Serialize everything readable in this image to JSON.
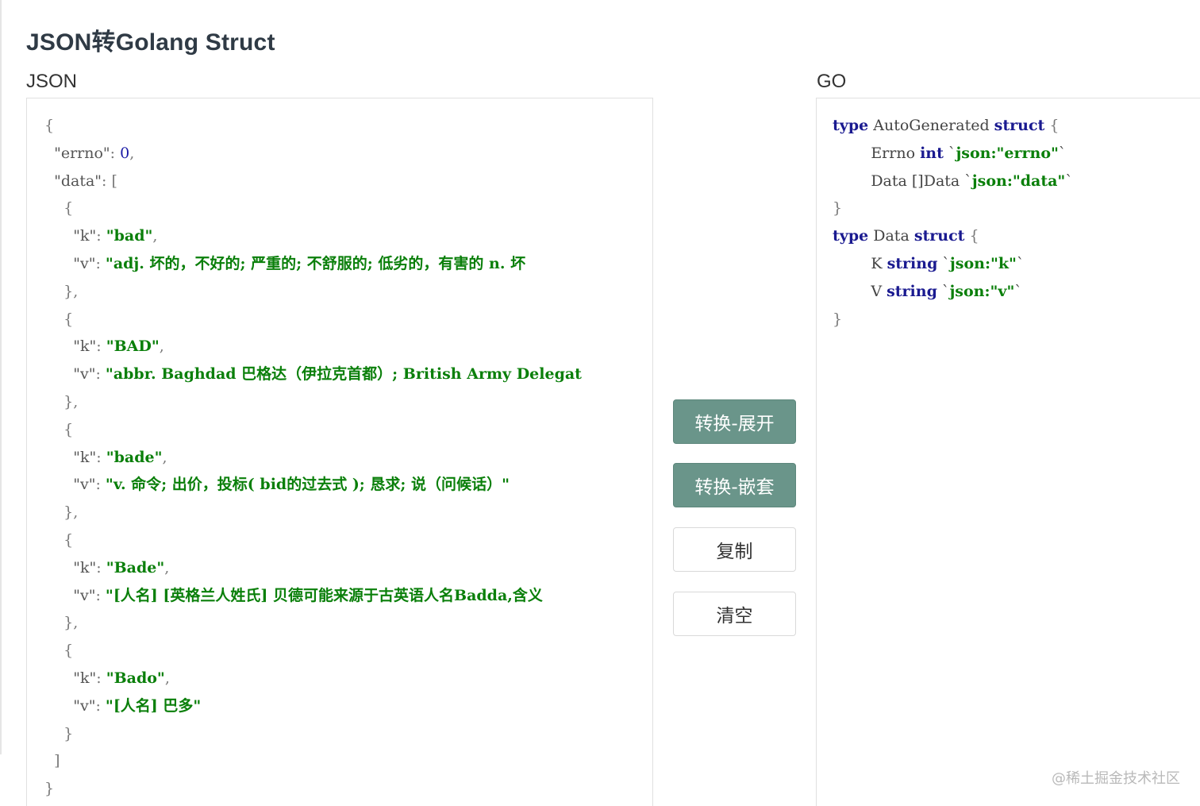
{
  "header": {
    "title": "JSON转Golang Struct"
  },
  "json_panel": {
    "label": "JSON",
    "lines": [
      [
        [
          "p",
          "{"
        ]
      ],
      [
        [
          "p",
          "  "
        ],
        [
          "key",
          "\"errno\""
        ],
        [
          "p",
          ": "
        ],
        [
          "num",
          "0"
        ],
        [
          "p",
          ","
        ]
      ],
      [
        [
          "p",
          "  "
        ],
        [
          "key",
          "\"data\""
        ],
        [
          "p",
          ": ["
        ]
      ],
      [
        [
          "p",
          "    {"
        ]
      ],
      [
        [
          "p",
          "      "
        ],
        [
          "key",
          "\"k\""
        ],
        [
          "p",
          ": "
        ],
        [
          "str",
          "\"bad\""
        ],
        [
          "p",
          ","
        ]
      ],
      [
        [
          "p",
          "      "
        ],
        [
          "key",
          "\"v\""
        ],
        [
          "p",
          ": "
        ],
        [
          "str",
          "\"adj. 坏的，不好的; 严重的; 不舒服的; 低劣的，有害的 n. 坏"
        ]
      ],
      [
        [
          "p",
          "    },"
        ]
      ],
      [
        [
          "p",
          "    {"
        ]
      ],
      [
        [
          "p",
          "      "
        ],
        [
          "key",
          "\"k\""
        ],
        [
          "p",
          ": "
        ],
        [
          "str",
          "\"BAD\""
        ],
        [
          "p",
          ","
        ]
      ],
      [
        [
          "p",
          "      "
        ],
        [
          "key",
          "\"v\""
        ],
        [
          "p",
          ": "
        ],
        [
          "str",
          "\"abbr. Baghdad 巴格达（伊拉克首都）; British Army Delegat"
        ]
      ],
      [
        [
          "p",
          "    },"
        ]
      ],
      [
        [
          "p",
          "    {"
        ]
      ],
      [
        [
          "p",
          "      "
        ],
        [
          "key",
          "\"k\""
        ],
        [
          "p",
          ": "
        ],
        [
          "str",
          "\"bade\""
        ],
        [
          "p",
          ","
        ]
      ],
      [
        [
          "p",
          "      "
        ],
        [
          "key",
          "\"v\""
        ],
        [
          "p",
          ": "
        ],
        [
          "str",
          "\"v. 命令; 出价，投标( bid的过去式 ); 恳求; 说（问候话）\""
        ]
      ],
      [
        [
          "p",
          "    },"
        ]
      ],
      [
        [
          "p",
          "    {"
        ]
      ],
      [
        [
          "p",
          "      "
        ],
        [
          "key",
          "\"k\""
        ],
        [
          "p",
          ": "
        ],
        [
          "str",
          "\"Bade\""
        ],
        [
          "p",
          ","
        ]
      ],
      [
        [
          "p",
          "      "
        ],
        [
          "key",
          "\"v\""
        ],
        [
          "p",
          ": "
        ],
        [
          "str",
          "\"[人名] [英格兰人姓氏] 贝德可能来源于古英语人名Badda,含义"
        ]
      ],
      [
        [
          "p",
          "    },"
        ]
      ],
      [
        [
          "p",
          "    {"
        ]
      ],
      [
        [
          "p",
          "      "
        ],
        [
          "key",
          "\"k\""
        ],
        [
          "p",
          ": "
        ],
        [
          "str",
          "\"Bado\""
        ],
        [
          "p",
          ","
        ]
      ],
      [
        [
          "p",
          "      "
        ],
        [
          "key",
          "\"v\""
        ],
        [
          "p",
          ": "
        ],
        [
          "str",
          "\"[人名] 巴多\""
        ]
      ],
      [
        [
          "p",
          "    }"
        ]
      ],
      [
        [
          "p",
          "  ]"
        ]
      ],
      [
        [
          "p",
          "}"
        ]
      ]
    ]
  },
  "go_panel": {
    "label": "GO",
    "lines": [
      [
        [
          "kw",
          "type"
        ],
        [
          "tname",
          " AutoGenerated "
        ],
        [
          "kw",
          "struct"
        ],
        [
          "p",
          " {"
        ]
      ],
      [
        [
          "tname",
          "        Errno "
        ],
        [
          "kw",
          "int"
        ],
        [
          "tname",
          " `"
        ],
        [
          "tag",
          "json:\"errno\""
        ],
        [
          "tname",
          "`"
        ]
      ],
      [
        [
          "tname",
          "        Data []Data `"
        ],
        [
          "tag",
          "json:\"data\""
        ],
        [
          "tname",
          "`"
        ]
      ],
      [
        [
          "p",
          "}"
        ]
      ],
      [
        [
          "kw",
          "type"
        ],
        [
          "tname",
          " Data "
        ],
        [
          "kw",
          "struct"
        ],
        [
          "p",
          " {"
        ]
      ],
      [
        [
          "tname",
          "        K "
        ],
        [
          "kw",
          "string"
        ],
        [
          "tname",
          " `"
        ],
        [
          "tag",
          "json:\"k\""
        ],
        [
          "tname",
          "`"
        ]
      ],
      [
        [
          "tname",
          "        V "
        ],
        [
          "kw",
          "string"
        ],
        [
          "tname",
          " `"
        ],
        [
          "tag",
          "json:\"v\""
        ],
        [
          "tname",
          "`"
        ]
      ],
      [
        [
          "p",
          "}"
        ]
      ]
    ]
  },
  "actions": {
    "expand_label": "转换-展开",
    "nested_label": "转换-嵌套",
    "copy_label": "复制",
    "clear_label": "清空"
  },
  "watermark": "@稀土掘金技术社区",
  "colors": {
    "primary_button": "#6a958a",
    "string_green": "#0a7f0a",
    "keyword_blue": "#1a1a90"
  }
}
